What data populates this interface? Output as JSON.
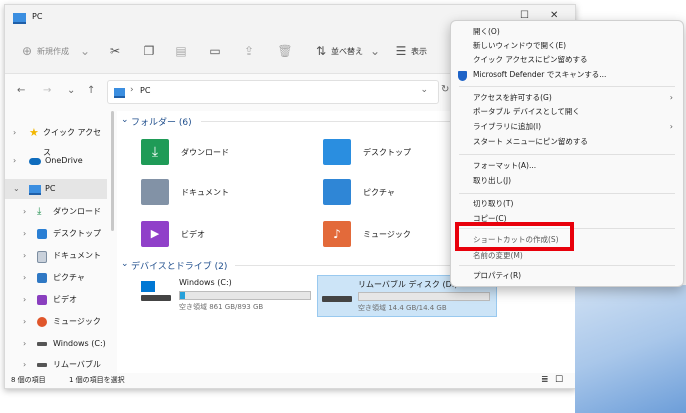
{
  "window": {
    "title": "PC",
    "minimize": "─",
    "maximize": "☐",
    "close": "✕"
  },
  "toolbar": {
    "new_label": "新規作成",
    "sort_label": "並べ替え",
    "view_label": "表示"
  },
  "address": {
    "location": "PC"
  },
  "sidebar": {
    "items": [
      {
        "label": "クイック アクセス",
        "icon": "star-icon",
        "color": "#f2b600"
      },
      {
        "label": "OneDrive",
        "icon": "cloud-icon",
        "color": "#0f6cbd"
      },
      {
        "label": "PC",
        "icon": "pc-icon",
        "color": "#3b8ee0"
      },
      {
        "label": "ダウンロード",
        "icon": "download-icon",
        "color": "#1f8f4e"
      },
      {
        "label": "デスクトップ",
        "icon": "desktop-icon",
        "color": "#2a7fd4"
      },
      {
        "label": "ドキュメント",
        "icon": "document-icon",
        "color": "#7d8ea1"
      },
      {
        "label": "ピクチャ",
        "icon": "pictures-icon",
        "color": "#2f78c4"
      },
      {
        "label": "ビデオ",
        "icon": "video-icon",
        "color": "#8a3fbf"
      },
      {
        "label": "ミュージック",
        "icon": "music-icon",
        "color": "#e0562b"
      },
      {
        "label": "Windows (C:)",
        "icon": "drive-icon",
        "color": "#555555"
      },
      {
        "label": "リムーバブル ディス",
        "icon": "removable-drive-icon",
        "color": "#555555"
      }
    ]
  },
  "content": {
    "folders_header": "フォルダー (6)",
    "folders": [
      {
        "label": "ダウンロード",
        "icon": "download-folder-icon",
        "color": "#1f9b57"
      },
      {
        "label": "デスクトップ",
        "icon": "desktop-folder-icon",
        "color": "#2a8ee0"
      },
      {
        "label": "ドキュメント",
        "icon": "documents-folder-icon",
        "color": "#8292a6"
      },
      {
        "label": "ピクチャ",
        "icon": "pictures-folder-icon",
        "color": "#2f86d6"
      },
      {
        "label": "ビデオ",
        "icon": "videos-folder-icon",
        "color": "#9040c9"
      },
      {
        "label": "ミュージック",
        "icon": "music-folder-icon",
        "color": "#e36a3a"
      }
    ],
    "drives_header": "デバイスとドライブ (2)",
    "drives": [
      {
        "label": "Windows (C:)",
        "free": "空き領域 861 GB/893 GB",
        "used_fraction": 0.04
      },
      {
        "label": "リムーバブル ディスク (D:)",
        "free": "空き領域 14.4 GB/14.4 GB",
        "used_fraction": 0.0
      }
    ]
  },
  "status": {
    "count": "8 個の項目",
    "selected": "1 個の項目を選択"
  },
  "context_menu": {
    "items": [
      "開く(O)",
      "新しいウィンドウで開く(E)",
      "クイック アクセスにピン留めする",
      "Microsoft Defender でスキャンする...",
      "アクセスを許可する(G)",
      "ポータブル デバイスとして開く",
      "ライブラリに追加(I)",
      "スタート メニューにピン留めする",
      "フォーマット(A)...",
      "取り出し(J)",
      "切り取り(T)",
      "コピー(C)",
      "ショートカットの作成(S)",
      "名前の変更(M)",
      "プロパティ(R)"
    ]
  },
  "colors": {
    "accent": "#0f6cbd",
    "highlight": "#e8000b",
    "selection": "#cce4f7"
  }
}
